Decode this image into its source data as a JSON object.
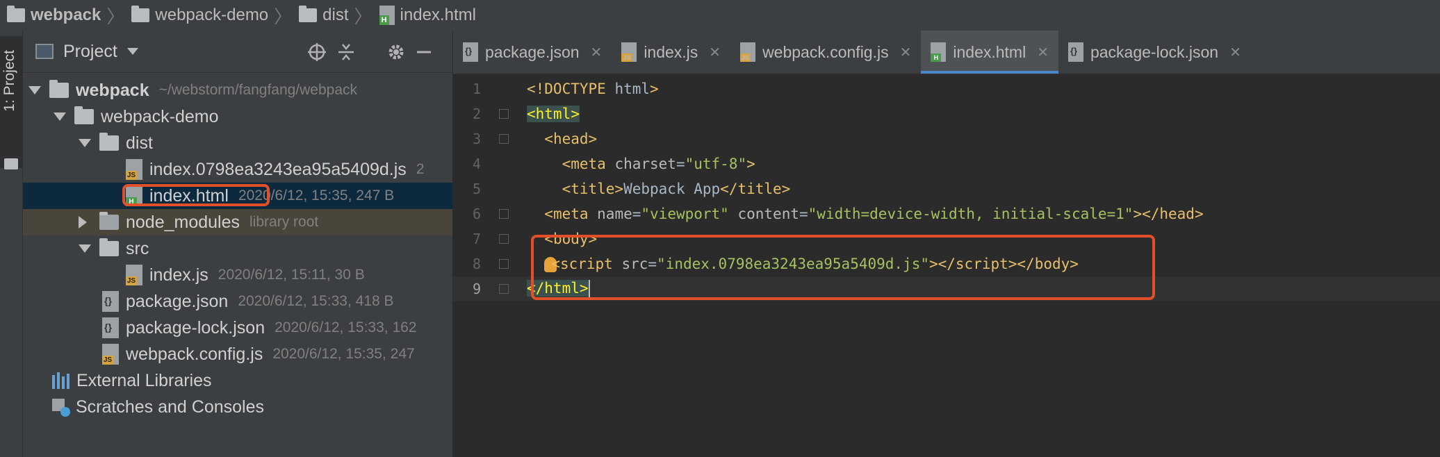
{
  "breadcrumb": [
    {
      "label": "webpack",
      "bold": true,
      "icon": "folder-icon"
    },
    {
      "label": "webpack-demo",
      "bold": false,
      "icon": "folder-icon"
    },
    {
      "label": "dist",
      "bold": false,
      "icon": "folder-icon"
    },
    {
      "label": "index.html",
      "bold": false,
      "icon": "html-file-icon"
    }
  ],
  "toolstrip": {
    "project_tab": "1: Project"
  },
  "project_panel": {
    "title": "Project",
    "tree": [
      {
        "label": "webpack",
        "meta": "~/webstorm/fangfang/webpack",
        "type": "folder",
        "expanded": true,
        "bold": true
      },
      {
        "label": "webpack-demo",
        "meta": "",
        "type": "folder",
        "expanded": true
      },
      {
        "label": "dist",
        "meta": "",
        "type": "folder",
        "expanded": true
      },
      {
        "label": "index.0798ea3243ea95a5409d.js",
        "meta": "2",
        "type": "js"
      },
      {
        "label": "index.html",
        "meta": "2020/6/12, 15:35, 247 B",
        "type": "html",
        "selected": true
      },
      {
        "label": "node_modules",
        "meta": "library root",
        "type": "folder",
        "expanded": false
      },
      {
        "label": "src",
        "meta": "",
        "type": "folder",
        "expanded": true
      },
      {
        "label": "index.js",
        "meta": "2020/6/12, 15:11, 30 B",
        "type": "js"
      },
      {
        "label": "package.json",
        "meta": "2020/6/12, 15:33, 418 B",
        "type": "json"
      },
      {
        "label": "package-lock.json",
        "meta": "2020/6/12, 15:33, 162",
        "type": "json"
      },
      {
        "label": "webpack.config.js",
        "meta": "2020/6/12, 15:35, 247",
        "type": "js"
      },
      {
        "label": "External Libraries",
        "meta": "",
        "type": "libraries"
      },
      {
        "label": "Scratches and Consoles",
        "meta": "",
        "type": "scratches"
      }
    ]
  },
  "tabs": [
    {
      "label": "package.json",
      "icon": "json-file-icon",
      "active": false
    },
    {
      "label": "index.js",
      "icon": "js-file-icon",
      "active": false
    },
    {
      "label": "webpack.config.js",
      "icon": "js-file-icon",
      "active": false
    },
    {
      "label": "index.html",
      "icon": "html-file-icon",
      "active": true
    },
    {
      "label": "package-lock.json",
      "icon": "json-file-icon",
      "active": false
    }
  ],
  "code": {
    "line_numbers": [
      "1",
      "2",
      "3",
      "4",
      "5",
      "6",
      "7",
      "8",
      "9"
    ],
    "current_line": 9
  },
  "colors": {
    "accent": "#4a88c7",
    "highlight_box": "#e2502a",
    "selection": "#0d293e"
  }
}
